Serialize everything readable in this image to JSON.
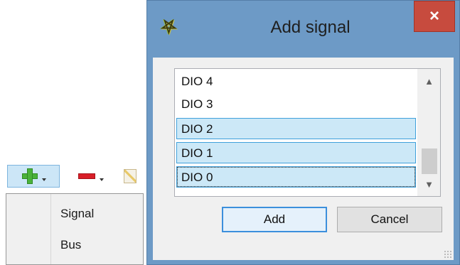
{
  "toolbar": {
    "add_icon": "plus-icon",
    "remove_icon": "minus-icon",
    "edit_icon": "pencil-icon"
  },
  "context_menu": {
    "items": [
      {
        "label": "Signal"
      },
      {
        "label": "Bus"
      }
    ]
  },
  "dialog": {
    "title": "Add signal",
    "close_label": "×",
    "list": {
      "items": [
        {
          "label": "DIO 4",
          "selected": false
        },
        {
          "label": "DIO 3",
          "selected": false
        },
        {
          "label": "DIO 2",
          "selected": true
        },
        {
          "label": "DIO 1",
          "selected": true
        },
        {
          "label": "DIO 0",
          "selected": true,
          "focused": true
        }
      ]
    },
    "buttons": {
      "add_label": "Add",
      "cancel_label": "Cancel"
    }
  },
  "colors": {
    "titlebar": "#6d9ac6",
    "close_button": "#c74b3e",
    "selection": "#cce8f7",
    "selection_border": "#3fa0db"
  }
}
